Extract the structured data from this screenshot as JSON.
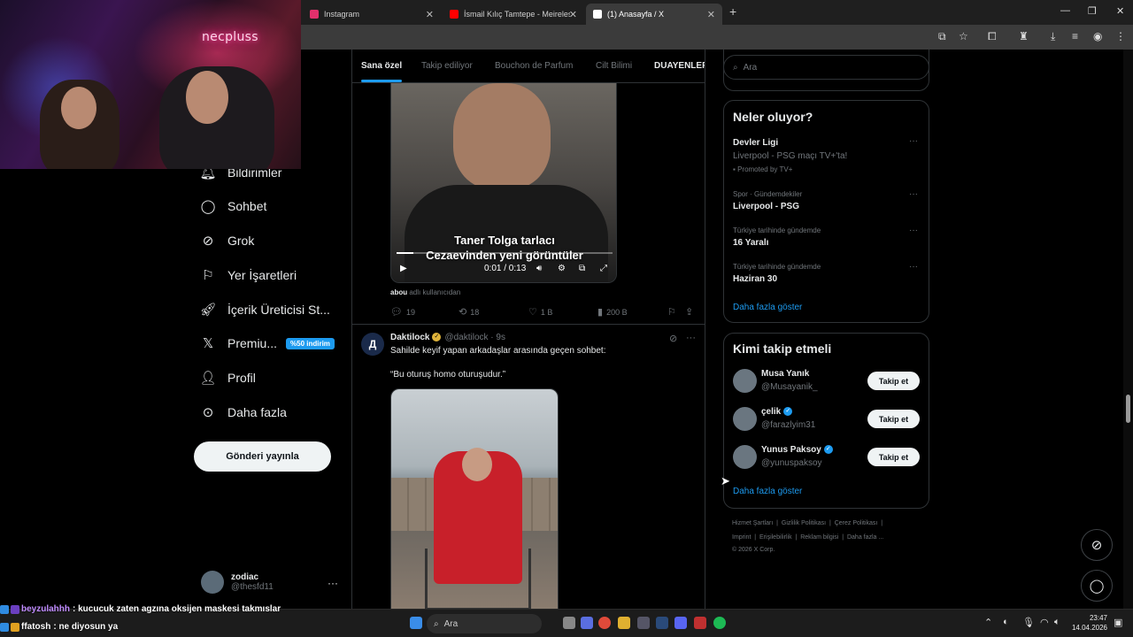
{
  "browser": {
    "tabs": [
      {
        "label": "Instagram",
        "color": "#e1306c"
      },
      {
        "label": "İsmail Kılıç Tamtepe - Meireles f",
        "color": "#ff0000"
      },
      {
        "label": "(1) Anasayfa / X",
        "color": "#ffffff"
      }
    ]
  },
  "webcam": {
    "neon_text": "necpluss"
  },
  "nav": {
    "items": [
      {
        "label": "Bildirimler",
        "icon": "bell-icon"
      },
      {
        "label": "Sohbet",
        "icon": "chat-icon"
      },
      {
        "label": "Grok",
        "icon": "grok-icon"
      },
      {
        "label": "Yer İşaretleri",
        "icon": "bookmark-icon"
      },
      {
        "label": "İçerik Üreticisi St...",
        "icon": "rocket-icon"
      },
      {
        "label": "Premiu...",
        "icon": "x-logo-icon",
        "badge": "%50 indirim"
      },
      {
        "label": "Profil",
        "icon": "person-icon"
      },
      {
        "label": "Daha fazla",
        "icon": "more-circle-icon"
      }
    ],
    "post_button": "Gönderi yayınla",
    "account": {
      "name": "zodiac",
      "handle": "@thesfd11",
      "more": "···"
    }
  },
  "feed": {
    "tabs": [
      "Sana özel",
      "Takip ediliyor",
      "Bouchon de Parfum",
      "Cilt Bilimi",
      "DUAYENLER"
    ],
    "video_post": {
      "title_line1": "Taner Tolga tarlacı",
      "title_line2": "Cezaevinden yeni görüntüler",
      "time": "0:01 / 0:13",
      "progress": 0.077,
      "source_user": "abou",
      "source_suffix": "adlı kullanıcıdan",
      "replies": "19",
      "reposts": "18",
      "likes": "1 B",
      "views": "200 B"
    },
    "post2": {
      "avatar_letter": "Д",
      "name": "Daktilock",
      "handle": "@daktilock · 9s",
      "text1": "Sahilde keyif yapan arkadaşlar arasında geçen sohbet:",
      "text2": "“Bu oturuş homo oturuşudur.”"
    }
  },
  "right": {
    "search_placeholder": "Ara",
    "trends_title": "Neler oluyor?",
    "trends": [
      {
        "meta": "",
        "title": "Devler Ligi",
        "sub": "Liverpool - PSG maçı TV+'ta!",
        "promo": "Promoted by TV+"
      },
      {
        "meta": "Spor · Gündemdekiler",
        "title": "Liverpool - PSG",
        "sub": "",
        "promo": ""
      },
      {
        "meta": "Türkiye tarihinde gündemde",
        "title": "16 Yaralı",
        "sub": "",
        "promo": ""
      },
      {
        "meta": "Türkiye tarihinde gündemde",
        "title": "Haziran 30",
        "sub": "",
        "promo": ""
      }
    ],
    "show_more": "Daha fazla göster",
    "who_title": "Kimi takip etmeli",
    "who": [
      {
        "name": "Musa Yanık",
        "handle": "@Musayanik_",
        "verified": false
      },
      {
        "name": "çelik",
        "handle": "@farazlyim31",
        "verified": true
      },
      {
        "name": "Yunus Paksoy",
        "handle": "@yunuspaksoy",
        "verified": true
      }
    ],
    "follow_label": "Takip et",
    "footer_line1": [
      "Hizmet Şartları",
      "Gizlilik Politikası",
      "Çerez Politikası"
    ],
    "footer_line2": [
      "Imprint",
      "Erişilebilirlik",
      "Reklam bilgisi",
      "Daha fazla ..."
    ],
    "copyright": "© 2026 X Corp."
  },
  "chat": [
    {
      "user": "beyzulahhh",
      "text": ": kucucuk zaten agzına oksijen maskesi takmıslar"
    },
    {
      "user": "ffatosh",
      "text": ": ne diyosun ya"
    }
  ],
  "taskbar": {
    "search": "Ara",
    "time": "23:47",
    "date": "14.04.2026"
  }
}
